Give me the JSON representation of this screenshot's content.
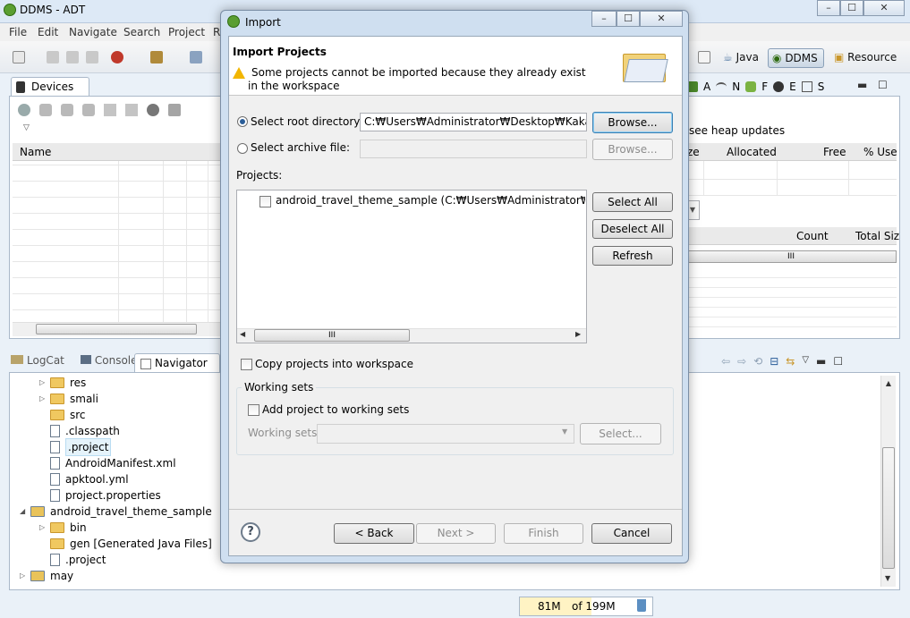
{
  "window": {
    "title": "DDMS - ADT",
    "controls": [
      "–",
      "☐",
      "✕"
    ]
  },
  "menu": [
    "File",
    "Edit",
    "Navigate",
    "Search",
    "Project",
    "R"
  ],
  "perspectives": [
    {
      "label": "Java",
      "active": false
    },
    {
      "label": "DDMS",
      "active": true
    },
    {
      "label": "Resource",
      "active": false
    }
  ],
  "devices_panel": {
    "tab": "Devices",
    "column": "Name"
  },
  "heap_panel": {
    "icons_text": [
      "A",
      "N",
      "F",
      "E",
      "S"
    ],
    "heap_updates": "see heap updates",
    "columns": [
      "ze",
      "Allocated",
      "Free",
      "% Use"
    ],
    "columns2": [
      "Count",
      "Total Siz"
    ],
    "thumb_text": "III"
  },
  "bottom_panel": {
    "tabs": [
      "LogCat",
      "Console",
      "Navigator"
    ],
    "tree": [
      {
        "label": "res",
        "type": "folder",
        "indent": 1,
        "arrow": "▷"
      },
      {
        "label": "smali",
        "type": "folder",
        "indent": 1,
        "arrow": "▷"
      },
      {
        "label": "src",
        "type": "folder",
        "indent": 1,
        "arrow": ""
      },
      {
        "label": ".classpath",
        "type": "file",
        "indent": 1,
        "arrow": ""
      },
      {
        "label": ".project",
        "type": "file",
        "indent": 1,
        "arrow": "",
        "selected": true
      },
      {
        "label": "AndroidManifest.xml",
        "type": "file",
        "indent": 1,
        "arrow": ""
      },
      {
        "label": "apktool.yml",
        "type": "file",
        "indent": 1,
        "arrow": ""
      },
      {
        "label": "project.properties",
        "type": "file",
        "indent": 1,
        "arrow": ""
      },
      {
        "label": "android_travel_theme_sample",
        "type": "project",
        "indent": 0,
        "arrow": "◢"
      },
      {
        "label": "bin",
        "type": "folder",
        "indent": 1,
        "arrow": "▷"
      },
      {
        "label": "gen [Generated Java Files]",
        "type": "folder",
        "indent": 1,
        "arrow": ""
      },
      {
        "label": ".project",
        "type": "file",
        "indent": 1,
        "arrow": ""
      },
      {
        "label": "may",
        "type": "project",
        "indent": 0,
        "arrow": "▷"
      }
    ]
  },
  "status": {
    "memory_used": "81M",
    "memory_total": "of 199M"
  },
  "dialog": {
    "title": "Import",
    "heading": "Import Projects",
    "message": "Some projects cannot be imported because they already exist in the workspace",
    "root_dir_label": "Select root directory:",
    "root_dir_value": "C:₩Users₩Administrator₩Desktop₩KakaoTalk_",
    "archive_label": "Select archive file:",
    "archive_value": "",
    "browse_label": "Browse...",
    "projects_label": "Projects:",
    "project_item": "android_travel_theme_sample (C:₩Users₩Administrator₩Desktop",
    "select_all": "Select All",
    "deselect_all": "Deselect All",
    "refresh": "Refresh",
    "copy_label": "Copy projects into workspace",
    "working_sets_group": "Working sets",
    "add_working_set": "Add project to working sets",
    "working_sets_label": "Working sets:",
    "select_btn": "Select...",
    "help": "?",
    "back": "< Back",
    "next": "Next >",
    "finish": "Finish",
    "cancel": "Cancel",
    "scroll_thumb": "III"
  },
  "colors": {
    "accent": "#3c7fb1",
    "window_bg": "#eaf1f8",
    "folder": "#f0c860"
  }
}
